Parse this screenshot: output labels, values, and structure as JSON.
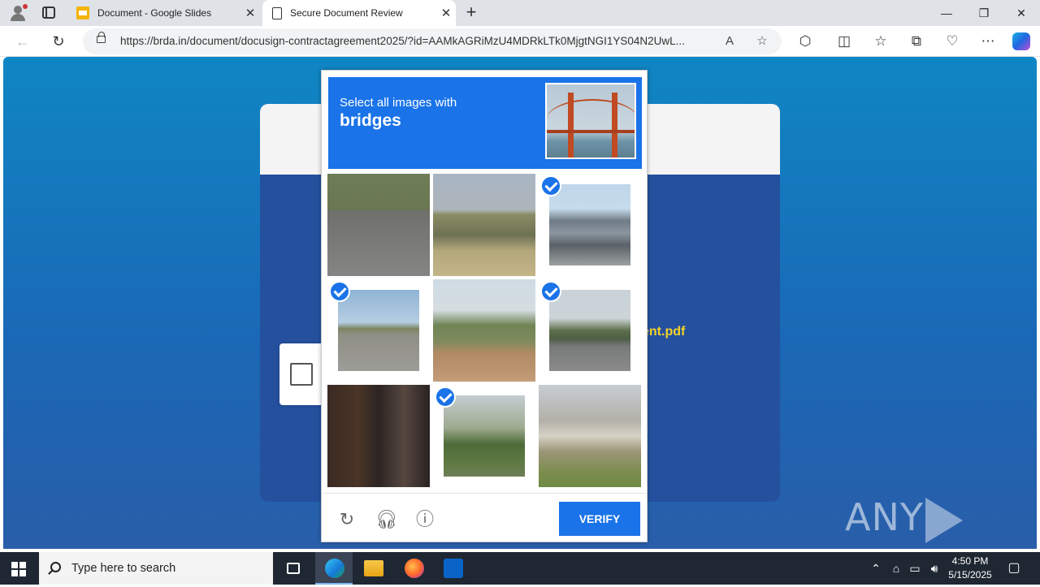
{
  "browser": {
    "tabs": [
      {
        "title": "Document - Google Slides",
        "active": false,
        "icon": "google-slides-icon"
      },
      {
        "title": "Secure Document Review",
        "active": true,
        "icon": "document-icon"
      }
    ],
    "url": "https://brda.in/document/docusign-contractagreement2025/?id=AAMkAGRiMzU4MDRkLTk0MjgtNGI1YS04N2UwL..."
  },
  "page": {
    "filename_fragment": "ent.pdf",
    "watermark_left": "ANY",
    "watermark_right": "RUN"
  },
  "captcha": {
    "instruction_line1": "Select all images with",
    "instruction_target": "bridges",
    "tiles": [
      {
        "subject": "cyclist on road",
        "selected": false
      },
      {
        "subject": "truck on highway with hills",
        "selected": false
      },
      {
        "subject": "highway overpass",
        "selected": true
      },
      {
        "subject": "highway overpass",
        "selected": true
      },
      {
        "subject": "roadside building",
        "selected": false
      },
      {
        "subject": "highway overpass",
        "selected": true
      },
      {
        "subject": "dark animal closeup",
        "selected": false
      },
      {
        "subject": "trees and house",
        "selected": true
      },
      {
        "subject": "house with bare trees",
        "selected": false
      }
    ],
    "verify_label": "VERIFY"
  },
  "taskbar": {
    "search_placeholder": "Type here to search",
    "time": "4:50 PM",
    "date": "5/15/2025"
  },
  "colors": {
    "captcha_blue": "#1a73e8",
    "filename_yellow": "#f5d327",
    "page_gradient_top": "#0f86c4",
    "page_gradient_bottom": "#295ea9"
  }
}
